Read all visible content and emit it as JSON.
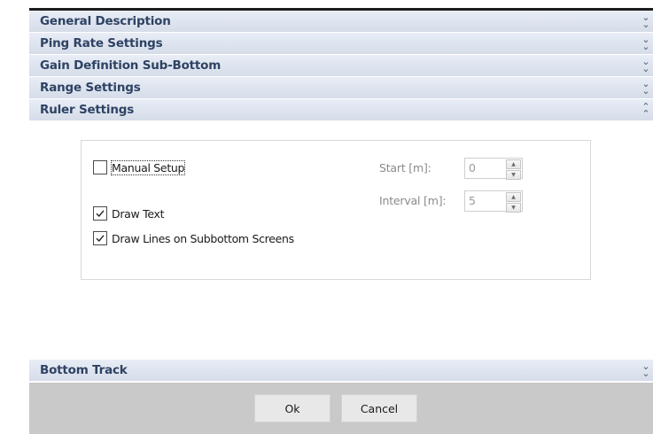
{
  "sections": {
    "general_description": "General Description",
    "ping_rate_settings": "Ping Rate Settings",
    "gain_definition": "Gain Definition Sub-Bottom",
    "range_settings": "Range Settings",
    "ruler_settings": "Ruler Settings",
    "bottom_track": "Bottom Track"
  },
  "icons": {
    "collapsed": "chevron-double-down-icon",
    "expanded": "chevron-double-up-icon"
  },
  "ruler": {
    "manual_setup": {
      "label": "Manual Setup",
      "checked": false
    },
    "draw_text": {
      "label": "Draw Text",
      "checked": true
    },
    "draw_lines": {
      "label": "Draw Lines on Subbottom Screens",
      "checked": true
    },
    "start": {
      "label": "Start [m]:",
      "value": "0"
    },
    "interval": {
      "label": "Interval [m]:",
      "value": "5"
    }
  },
  "footer": {
    "ok_label": "Ok",
    "cancel_label": "Cancel"
  }
}
